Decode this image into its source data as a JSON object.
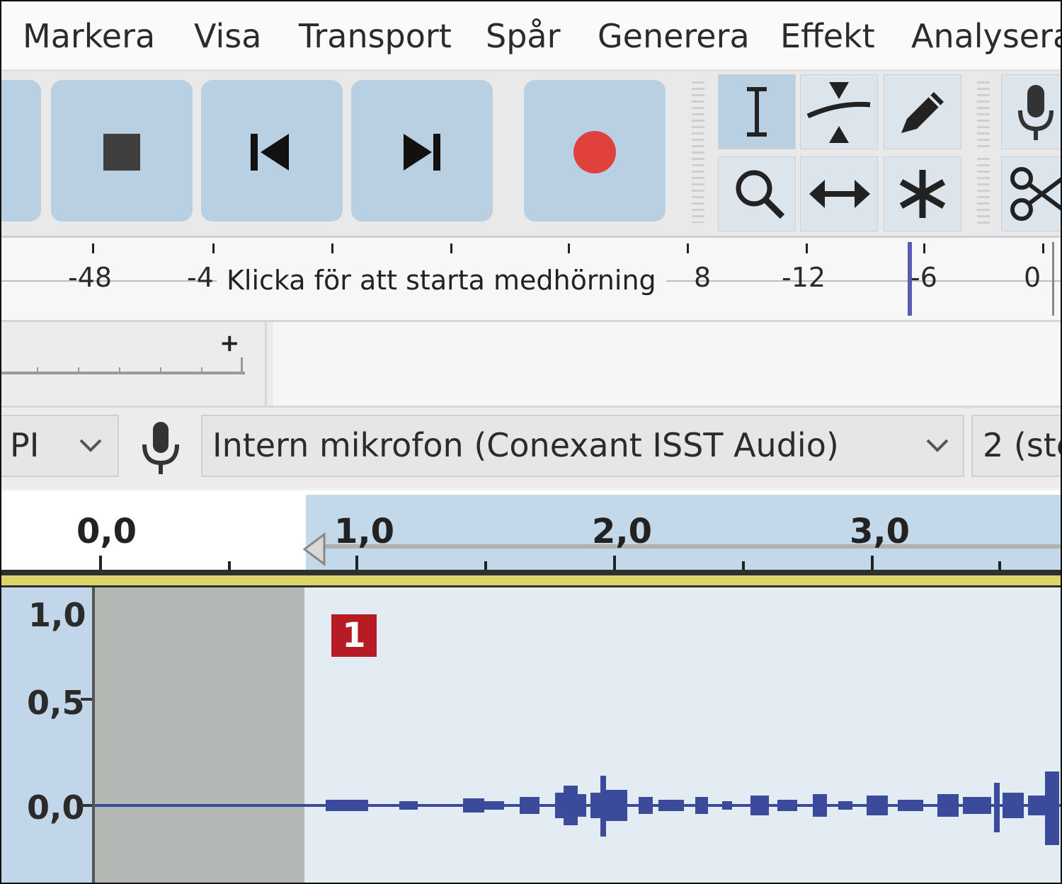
{
  "menu": [
    "Markera",
    "Visa",
    "Transport",
    "Spår",
    "Generera",
    "Effekt",
    "Analysera"
  ],
  "meter": {
    "tooltip": "Klicka för att starta medhörning",
    "labels": [
      "-48",
      "-4",
      "8",
      "-12",
      "-6",
      "0"
    ]
  },
  "slider": {
    "plus": "+"
  },
  "devices": {
    "host": "PI",
    "input": "Intern mikrofon (Conexant ISST Audio)",
    "channels": "2 (ste"
  },
  "timeline": {
    "labels": [
      "0,0",
      "1,0",
      "2,0",
      "3,0"
    ]
  },
  "track": {
    "scale": [
      "1,0",
      "0,5",
      "0,0"
    ],
    "marker": "1",
    "waveform_color": "#3b4a9a"
  },
  "colors": {
    "accent": "#b9d0e3",
    "record": "#e0413d",
    "badge": "#b71c24"
  }
}
